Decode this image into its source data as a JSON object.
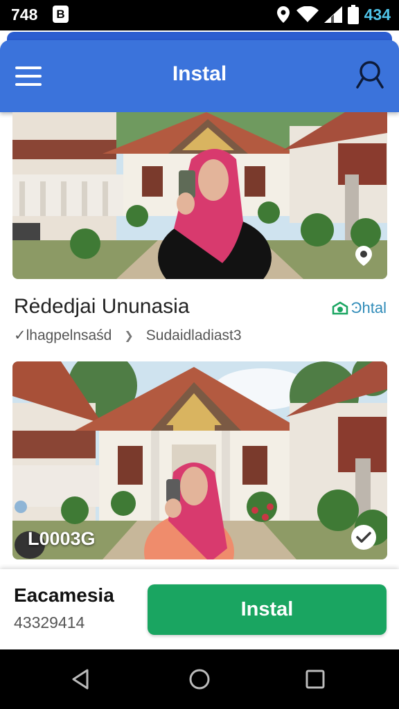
{
  "status_bar": {
    "time": "748",
    "badge": "B",
    "battery_percent": "434"
  },
  "app_bar": {
    "title": "Instal",
    "menu_icon": "hamburger-menu-icon",
    "search_icon": "search-icon",
    "color": "#3b73db"
  },
  "listing1": {
    "name": "Rėdedjai Ununasia",
    "link_label": "Ͽhtal",
    "meta_left": "✓lhagpelnsaśd",
    "meta_right": "Sudaidladiast3"
  },
  "listing2": {
    "overlay_label": "L0003G"
  },
  "bottom_bar": {
    "name": "Eacamesia",
    "number": "43329414",
    "button_label": "Instal",
    "button_color": "#1aa561"
  },
  "nav": {
    "back": "back-icon",
    "home": "home-icon",
    "recents": "recents-icon"
  }
}
